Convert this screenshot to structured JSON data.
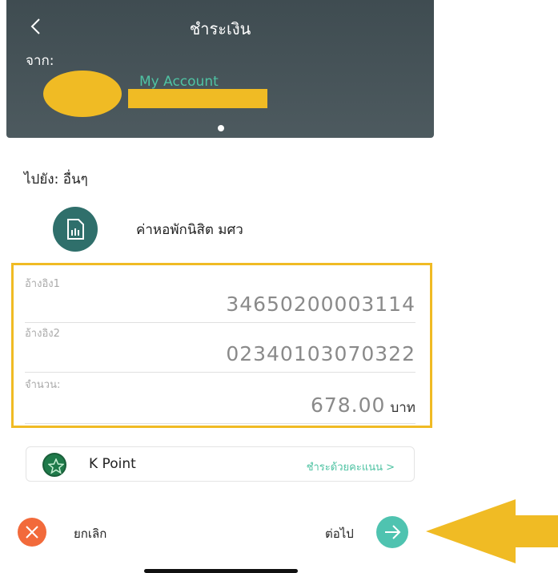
{
  "header": {
    "title": "ชำระเงิน",
    "from_label": "จาก:",
    "account_name": "My Account"
  },
  "destination": {
    "to_label": "ไปยัง: อื่นๆ",
    "biller_name": "ค่าหอพักนิสิต มศว",
    "biller_icon": "bill-document-icon"
  },
  "fields": {
    "ref1": {
      "label": "อ้างอิง1",
      "value": "34650200003114"
    },
    "ref2": {
      "label": "อ้างอิง2",
      "value": "02340103070322"
    },
    "amount": {
      "label": "จำนวน:",
      "value": "678.00",
      "unit": "บาท"
    }
  },
  "kpoint": {
    "label": "K Point",
    "link": "ชำระด้วยคะแนน >",
    "icon": "star-icon"
  },
  "actions": {
    "cancel_label": "ยกเลิก",
    "next_label": "ต่อไป"
  },
  "colors": {
    "header_bg": "#46545a",
    "accent_green": "#4fc3a3",
    "highlight_yellow": "#f0bb24",
    "cancel_orange": "#f26a3b",
    "next_teal": "#4fc3b0"
  }
}
